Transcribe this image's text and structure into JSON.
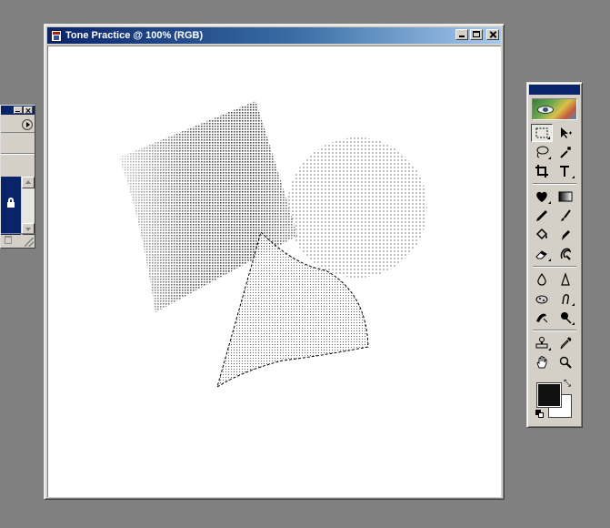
{
  "document_window": {
    "title": "Tone Practice @ 100% (RGB)",
    "icon": "photoshop-document-icon",
    "buttons": [
      "minimize",
      "maximize",
      "close"
    ]
  },
  "canvas": {
    "background": "#ffffff",
    "shapes": [
      "tilted-square-halftone",
      "circle-dot-pattern",
      "curved-triangle-selection"
    ]
  },
  "side_palette": {
    "buttons": [
      "minimize",
      "close",
      "palette-menu"
    ],
    "icons": [
      "lock-icon",
      "trash-icon",
      "resize-grip-icon"
    ]
  },
  "toolbox": {
    "title_color": "#0a246a",
    "tool_rows": [
      [
        "rectangular-marquee-tool",
        "move-tool"
      ],
      [
        "lasso-tool",
        "magic-wand-tool"
      ],
      [
        "crop-tool",
        "type-tool"
      ],
      [
        "airbrush-tool",
        "gradient-tool"
      ],
      [
        "pencil-tool",
        "paintbrush-tool"
      ],
      [
        "paint-bucket-tool",
        "pen-tool"
      ],
      [
        "eraser-tool",
        "history-brush-tool"
      ],
      [
        "blur-tool",
        "sharpen-tool"
      ],
      [
        "sponge-tool",
        "smudge-tool"
      ],
      [
        "rubber-stamp-tool",
        "dodge-tool"
      ],
      [
        "stamp-tool",
        "eyedropper-tool"
      ],
      [
        "hand-tool",
        "zoom-tool"
      ]
    ],
    "foreground_color": "#111111",
    "background_color": "#ffffff"
  }
}
